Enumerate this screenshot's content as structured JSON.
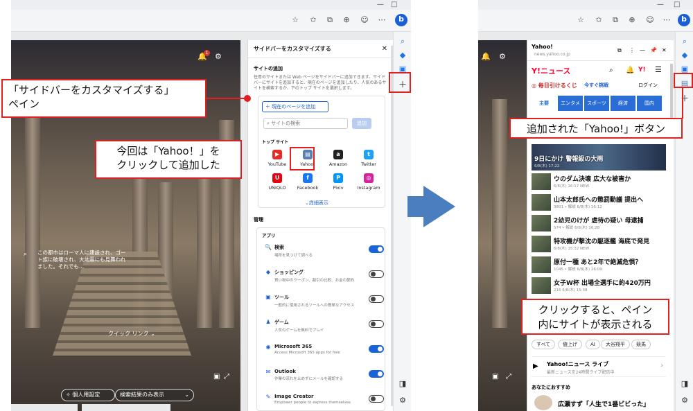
{
  "left": {
    "background_caption": "この都市はローマ人に建設され、ゴート族に破壊され、大地震にも見舞われました。それでも…",
    "notification_count": "1",
    "quick_link": "クイック リンク",
    "personal_settings": "個人用設定",
    "search_results_only": "検索結果のみ表示",
    "panel": {
      "title": "サイドバーをカスタマイズする",
      "add_site_heading": "サイトの追加",
      "add_site_desc": "任意のサイトまたは Web ページをサイドバーに追加できます。サイドバーにサイトを追加すると、現在のページを追加したり、人気のあるサイトを検索するか、下のトップ サイトを選択します。",
      "add_current_page": "現在のページを追加",
      "search_placeholder": "サイトの検索",
      "add_button": "追加",
      "top_sites_heading": "トップ サイト",
      "top_sites": [
        {
          "name": "YouTube",
          "color": "#e52d27",
          "glyph": "▶"
        },
        {
          "name": "Yahoo!",
          "color": "#5b7fb0",
          "glyph": "▤"
        },
        {
          "name": "Amazon",
          "color": "#222222",
          "glyph": "a"
        },
        {
          "name": "Twitter",
          "color": "#1da1f2",
          "glyph": "t"
        },
        {
          "name": "UNIQLO",
          "color": "#e60012",
          "glyph": "U"
        },
        {
          "name": "Facebook",
          "color": "#1877f2",
          "glyph": "f"
        },
        {
          "name": "Pixiv",
          "color": "#0096fa",
          "glyph": "P"
        },
        {
          "name": "Instagram",
          "color": "#d6249f",
          "glyph": "◎"
        }
      ],
      "details": "詳細表示",
      "manage_heading": "管理",
      "apps_heading": "アプリ",
      "apps": [
        {
          "name": "検索",
          "desc": "場所を見つけて調べる",
          "on": true,
          "icon": "🔍"
        },
        {
          "name": "ショッピング",
          "desc": "買い物中のクーポン、割引の比較、お金の節約",
          "on": false,
          "icon": "◆"
        },
        {
          "name": "ツール",
          "desc": "一般的に使用されるツールへの簡単なアクセス",
          "on": false,
          "icon": "▣"
        },
        {
          "name": "ゲーム",
          "desc": "人気のゲームを無料でプレイ",
          "on": false,
          "icon": "♟"
        },
        {
          "name": "Microsoft 365",
          "desc": "Access Microsoft 365 apps for free",
          "on": true,
          "icon": "◉"
        },
        {
          "name": "Outlook",
          "desc": "作業の流れを止めずにメールを確認する",
          "on": true,
          "icon": "✉"
        },
        {
          "name": "Image Creator",
          "desc": "Empower people to express themselves",
          "on": false,
          "icon": "✎"
        }
      ]
    },
    "callout_pane": "「サイドバーをカスタマイズする」\nペイン",
    "callout_yahoo": "今回は「Yahoo！」を\nクリックして追加した"
  },
  "right": {
    "panel_title": "Yahoo!",
    "panel_url": "news.yahoo.co.jp",
    "brand": "Y!ニュース",
    "lottery": "毎日引けるくじ",
    "challenge": "今すぐ挑戦",
    "login": "ログイン",
    "tabs": [
      "主要",
      "エンタメ",
      "スポーツ",
      "経済",
      "国内"
    ],
    "hero_caption": "9日にかけ 警報級の大雨",
    "hero_date": "6/8(木) 17:22",
    "news": [
      {
        "title": "ウのダム決壊 広大な被害か",
        "meta": "6/8(木) 16:17 NEW"
      },
      {
        "title": "山本太郎氏への懲罰動議 提出へ",
        "meta": "3801 • 解説 6/8(木) 16:12"
      },
      {
        "title": "2幼児のけが 虐待の疑い 母逮捕",
        "meta": "574 • 解説 6/8(木) 16:28"
      },
      {
        "title": "特攻機が撃沈の駆逐艦 海底で発見",
        "meta": "6/8(木) 15:32 NEW"
      },
      {
        "title": "原付一種 あと2年で絶滅危惧？",
        "meta": "1045 • 解説 6/8(木) 16:09"
      },
      {
        "title": "女子W杯 出場全選手に約420万円",
        "meta": "216 6/8(木) 15:38"
      }
    ],
    "chips": [
      "すべて",
      "値上げ",
      "AI",
      "大谷翔平",
      "競馬"
    ],
    "live_title": "Yahoo!ニュース ライブ",
    "live_sub": "最新ニュースを24時間ライブ配信中",
    "recommend": "あなたにおすすめ",
    "rec_item": "広瀬すず「人生で1番ビビった」",
    "callout_button": "追加された「Yahoo!」ボタン",
    "callout_display": "クリックすると、ペイン\n内にサイトが表示される"
  }
}
